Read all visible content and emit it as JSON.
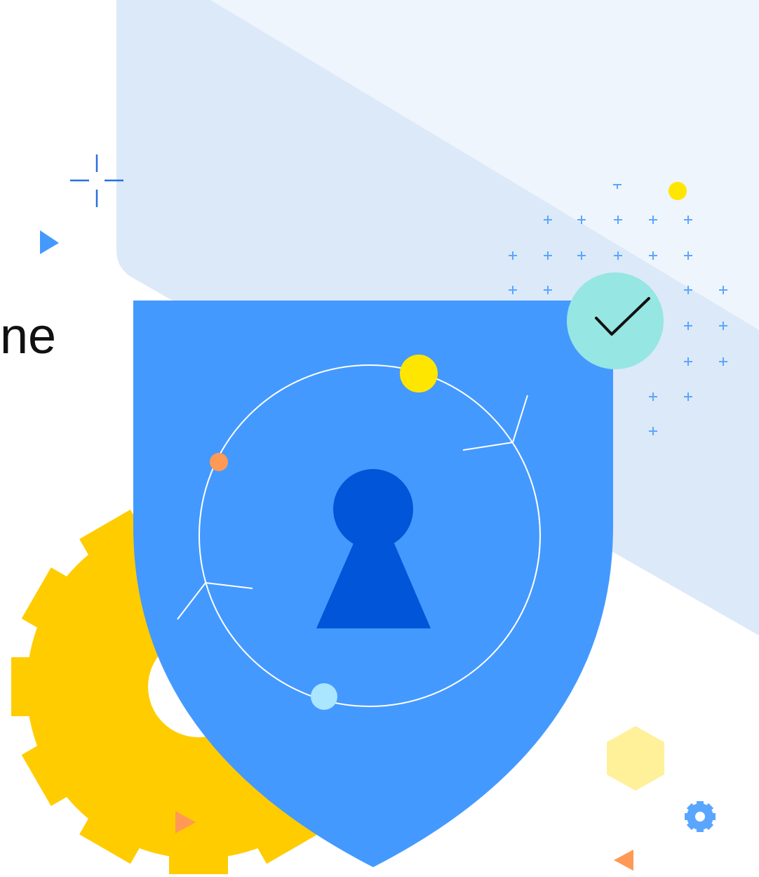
{
  "headline": {
    "visible_fragment": "ne"
  },
  "icons": {
    "shield": "shield-icon",
    "keyhole": "keyhole-icon",
    "check": "checkmark-icon",
    "gear": "gear-icon",
    "small_gear": "small-gear-icon",
    "hexagon": "hexagon-icon",
    "play": "play-triangle-icon"
  },
  "colors": {
    "panel": "#dce9f8",
    "panel_light": "#eef5fd",
    "shield": "#4499ff",
    "keyhole": "#0055d9",
    "gear": "#ffcc00",
    "check_circle": "#96e6e3",
    "yellow_dot": "#ffe600",
    "orange_dot": "#ff9955",
    "cyan_dot": "#aae6ff",
    "hexagon": "#fff09a",
    "plus_marks": "#5aa6ff",
    "crosshair": "#2a6fe0"
  }
}
